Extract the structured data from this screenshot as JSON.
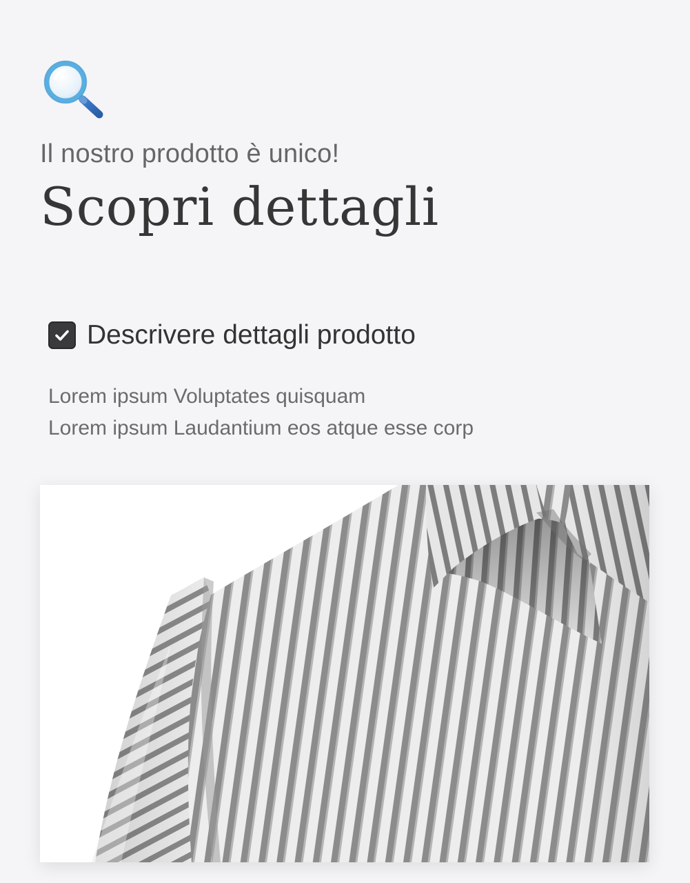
{
  "icons": {
    "search": "magnifying-glass-icon",
    "checkbox": "checkmark-icon"
  },
  "hero": {
    "subtitle": "Il nostro prodotto è unico!",
    "title": "Scopri dettagli"
  },
  "feature": {
    "checked": true,
    "label": "Descrivere dettagli prodotto",
    "description": [
      "Lorem ipsum Voluptates quisquam",
      "Lorem ipsum Laudantium eos atque esse corp"
    ]
  },
  "product_image": {
    "subject": "striped-shirt",
    "stripe_color": "#8a8a8a",
    "fabric_color": "#eeeeee"
  },
  "colors": {
    "background": "#f5f5f7",
    "text_primary": "#333333",
    "text_secondary": "#6b6b6b",
    "checkbox": "#3a3a3c",
    "icon_blue": "#5aaee0"
  }
}
